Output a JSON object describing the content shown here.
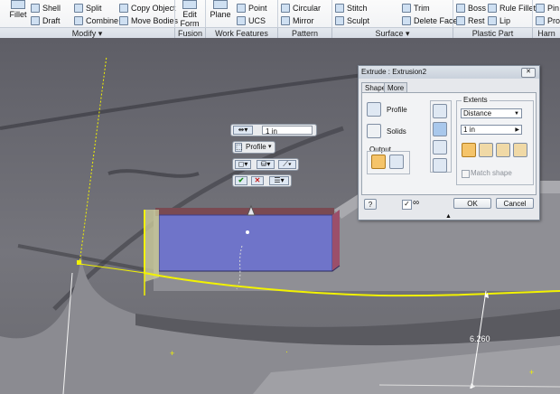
{
  "ribbon": {
    "modify": {
      "fillet": "Fillet",
      "shell": "Shell",
      "draft": "Draft",
      "split": "Split",
      "combine": "Combine",
      "copy_object": "Copy Object",
      "move_bodies": "Move Bodies"
    },
    "fusion": {
      "edit_form": "Edit Form"
    },
    "work_features": {
      "plane": "Plane",
      "point": "Point",
      "ucs": "UCS"
    },
    "pattern": {
      "circular": "Circular",
      "mirror": "Mirror"
    },
    "surface": {
      "stitch": "Stitch",
      "sculpt": "Sculpt",
      "trim": "Trim",
      "delete_face": "Delete Face"
    },
    "plastic_part": {
      "boss": "Boss",
      "rest": "Rest",
      "rule_fillet": "Rule Fillet",
      "lip": "Lip"
    },
    "harness": {
      "pin": "Pin G",
      "prop": "Prop"
    },
    "groups": {
      "modify": "Modify ▾",
      "fusion": "Fusion",
      "work_features": "Work Features",
      "pattern": "Pattern",
      "surface": "Surface ▾",
      "plastic_part": "Plastic Part",
      "harness": "Harn"
    }
  },
  "mini_toolbar": {
    "distance_value": "1 in",
    "profile_label": "Profile"
  },
  "dimension": {
    "value": "6.260"
  },
  "dialog": {
    "title": "Extrude : Extrusion2",
    "close": "✕",
    "tabs": {
      "shape": "Shape",
      "more": "More"
    },
    "profile_label": "Profile",
    "solids_label": "Solids",
    "output_label": "Output",
    "extents_label": "Extents",
    "extents_value": "Distance",
    "distance_value": "1 in",
    "match_shape": "Match shape",
    "help": "?",
    "ok": "OK",
    "cancel": "Cancel"
  },
  "colors": {
    "accent": "#f5c46a",
    "preview_face": "#6f74c9",
    "sketch_line": "#f2f200"
  }
}
